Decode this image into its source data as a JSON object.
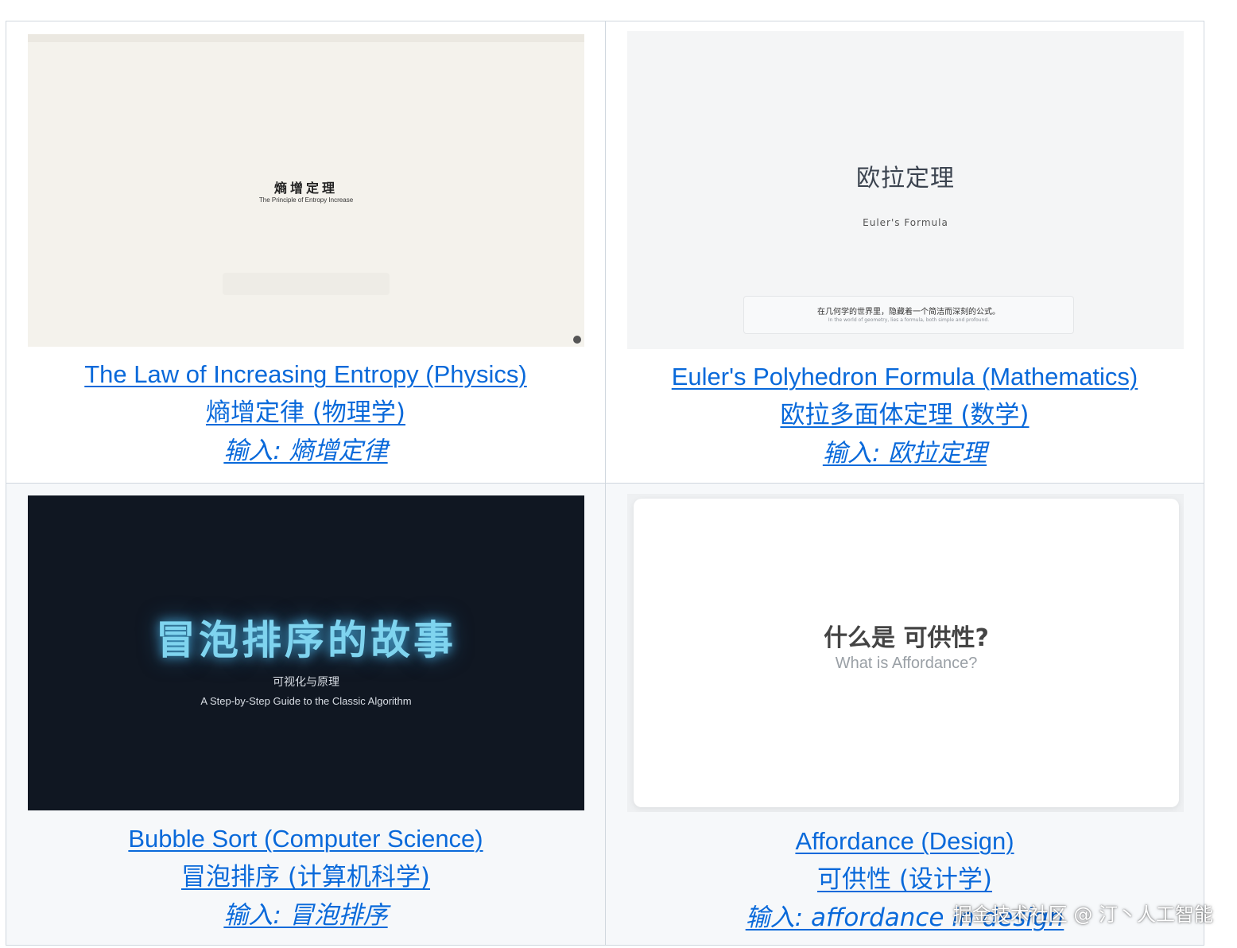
{
  "watermark": "掘金技术社区 @ 汀丶人工智能",
  "items": [
    {
      "slide": {
        "title": "熵增定理",
        "subtitle": "The Principle of Entropy Increase"
      },
      "link_en": "The Law of Increasing Entropy (Physics)",
      "link_zh": "熵增定律 (物理学)",
      "link_input": "输入: 熵增定律"
    },
    {
      "slide": {
        "title": "欧拉定理",
        "subtitle": "Euler's Formula",
        "box_line1": "在几何学的世界里，隐藏着一个简洁而深刻的公式。",
        "box_line2": "In the world of geometry, lies a formula, both simple and profound."
      },
      "link_en": "Euler's Polyhedron Formula (Mathematics)",
      "link_zh": "欧拉多面体定理 (数学)",
      "link_input": "输入: 欧拉定理"
    },
    {
      "slide": {
        "title": "冒泡排序的故事",
        "subtitle": "可视化与原理",
        "subtitle2": "A Step-by-Step Guide to the Classic Algorithm"
      },
      "link_en": "Bubble Sort (Computer Science)",
      "link_zh": "冒泡排序 (计算机科学)",
      "link_input": "输入: 冒泡排序"
    },
    {
      "slide": {
        "title": "什么是 可供性?",
        "subtitle": "What is Affordance?"
      },
      "link_en": "Affordance (Design)",
      "link_zh": "可供性 (设计学)",
      "link_input": "输入: affordance in design"
    }
  ],
  "colors": {
    "link": "#0969da",
    "border": "#d0d7de",
    "alt_row": "#f6f8fa"
  }
}
